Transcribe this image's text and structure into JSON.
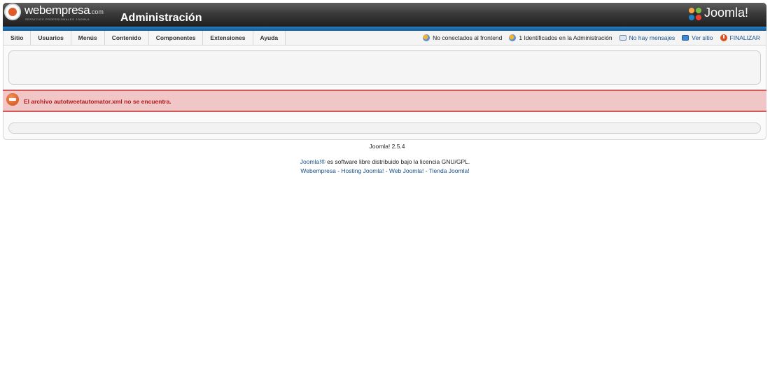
{
  "header": {
    "brand_name": "webempresa",
    "brand_suffix": ".com",
    "brand_sub": "SERVICIOS PROFESIONALES JOOMLA",
    "title": "Administración",
    "joomla_logo_text": "Joomla!",
    "colors": {
      "header_dark": "#2a2a2a",
      "accent_blue": "#1a6aaa"
    }
  },
  "menu": {
    "items": [
      {
        "label": "Sitio"
      },
      {
        "label": "Usuarios"
      },
      {
        "label": "Menús"
      },
      {
        "label": "Contenido"
      },
      {
        "label": "Componentes"
      },
      {
        "label": "Extensiones"
      },
      {
        "label": "Ayuda"
      }
    ]
  },
  "status": {
    "frontend_label": "No conectados al frontend",
    "admin_label": "1 Identificados en la Administración",
    "messages_label": "No hay mensajes",
    "view_site_label": "Ver sitio",
    "logout_label": "FINALIZAR"
  },
  "error": {
    "message": "El archivo autotweetautomator.xml no se encuentra.",
    "color": "#b01c1c",
    "background": "#f1c6c6"
  },
  "footer": {
    "version": "Joomla! 2.5.4",
    "joomla_link": "Joomla!®",
    "license_text": " es software libre distribuido bajo la licencia GNU/GPL.",
    "link_webempresa": "Webempresa",
    "link_hosting": "Hosting Joomla!",
    "link_web": "Web Joomla!",
    "link_tienda": "Tienda Joomla!",
    "separator": " - "
  }
}
